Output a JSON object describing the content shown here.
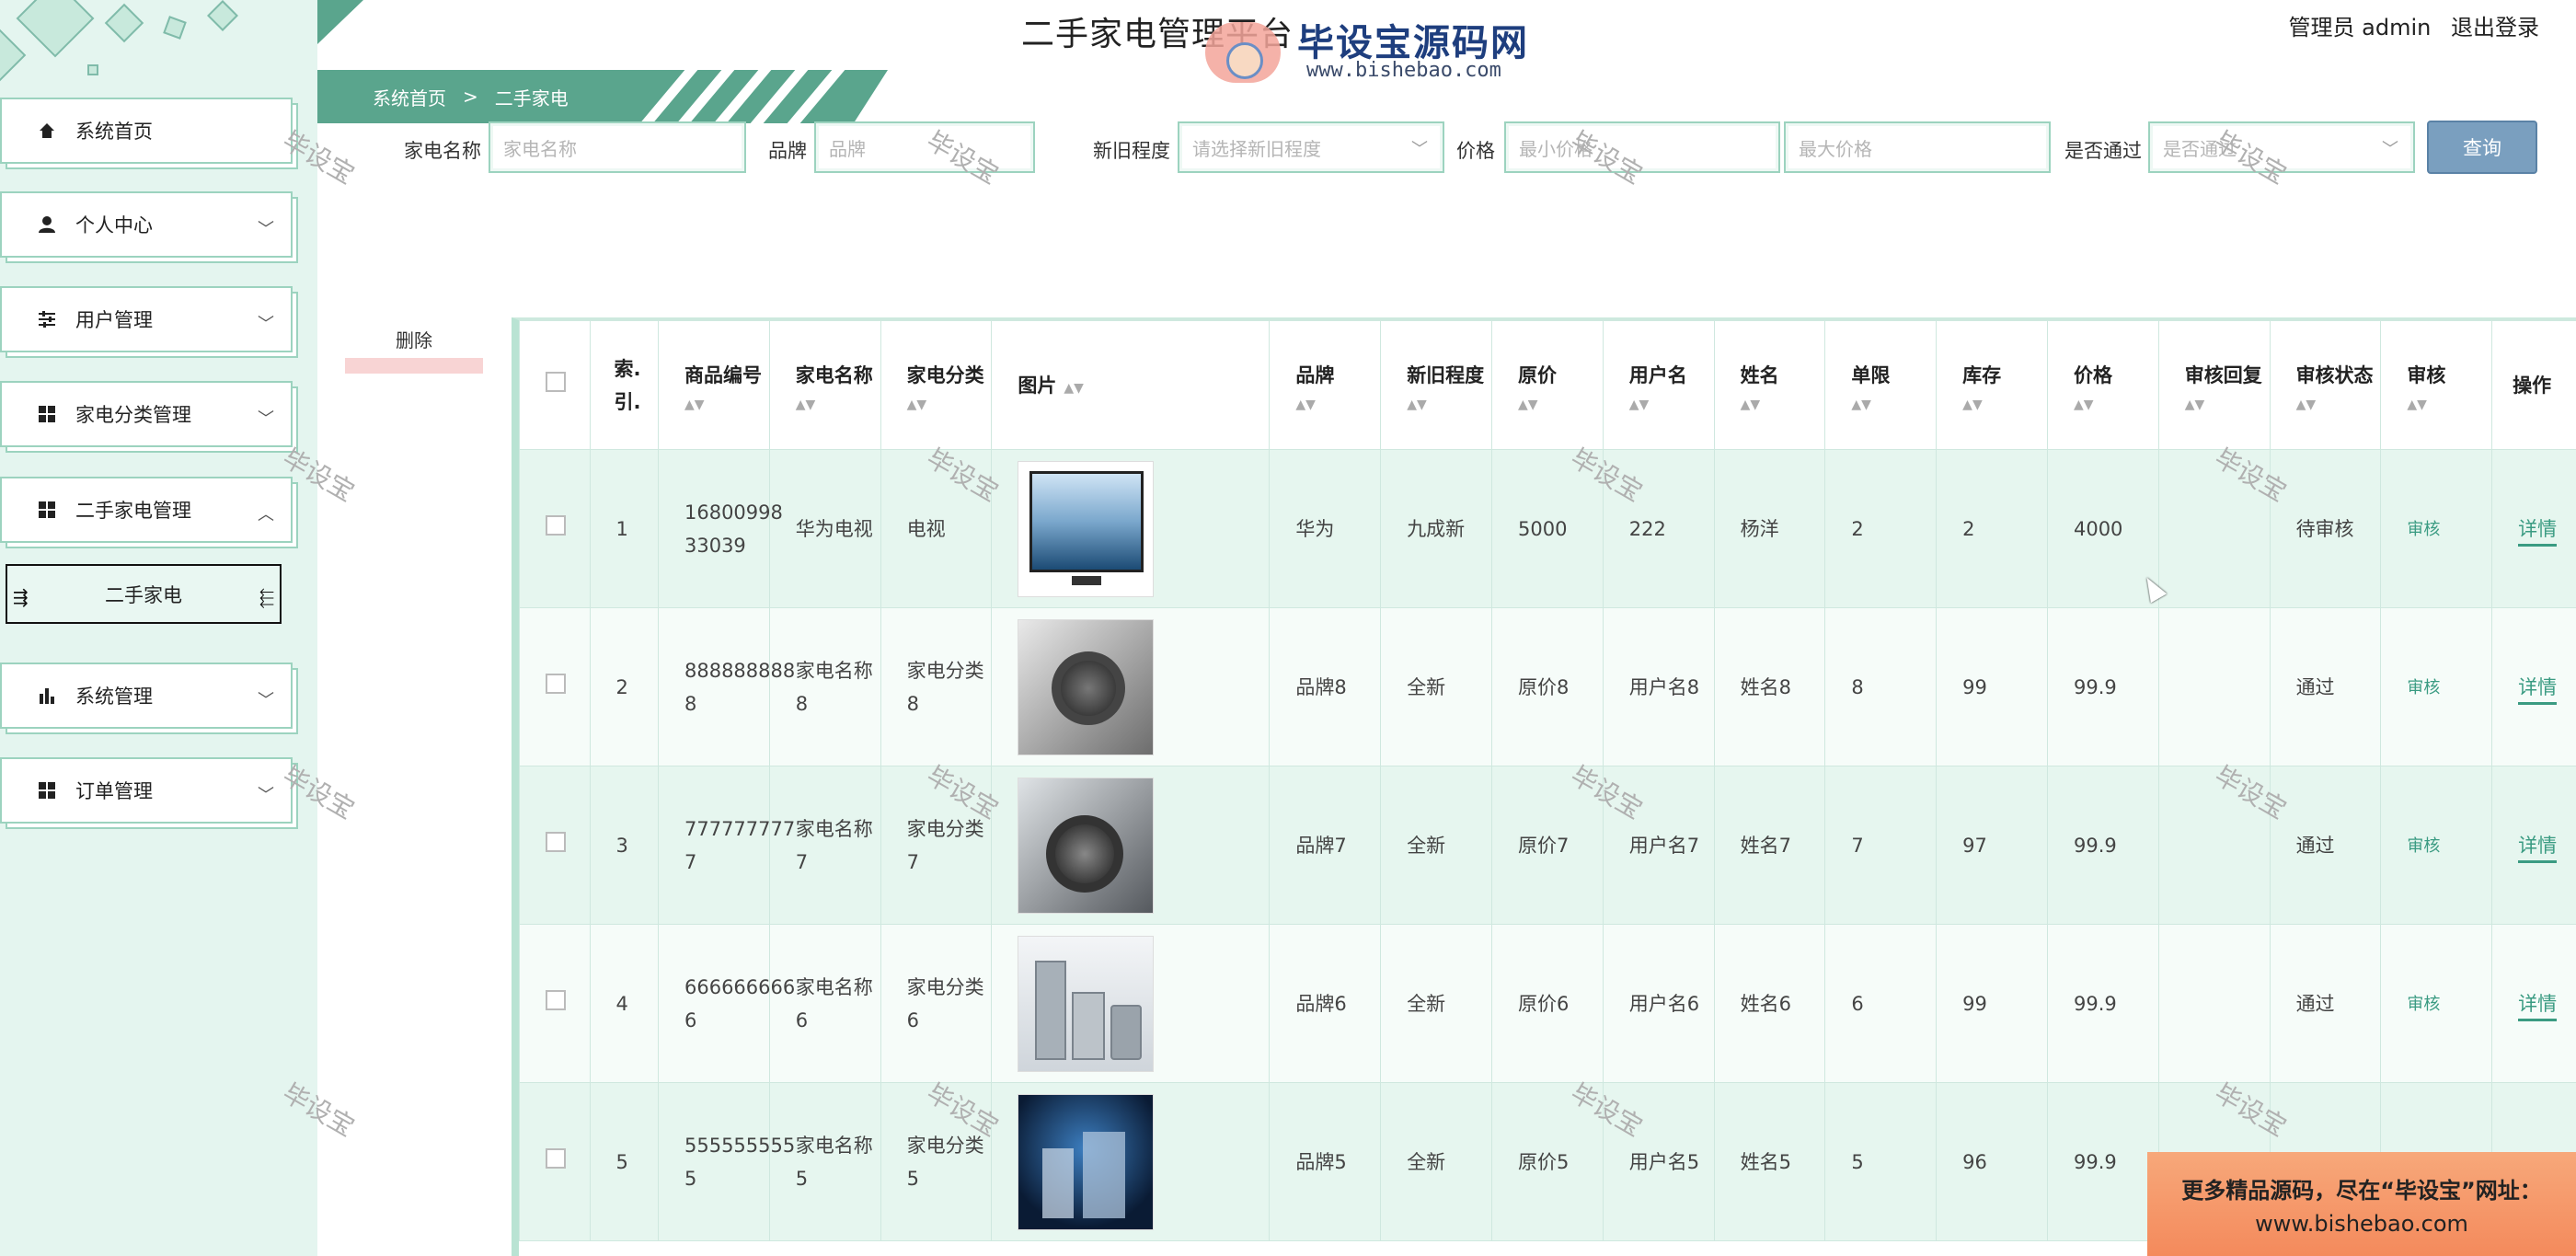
{
  "app": {
    "title": "二手家电管理平台",
    "user_text": "管理员 admin",
    "logout": "退出登录",
    "logo_name": "毕设宝源码网",
    "logo_url": "www.bishebao.com"
  },
  "sidebar": {
    "items": [
      {
        "label": "系统首页",
        "icon": "home-icon",
        "expandable": false
      },
      {
        "label": "个人中心",
        "icon": "user-icon",
        "expandable": true
      },
      {
        "label": "用户管理",
        "icon": "sliders-icon",
        "expandable": true
      },
      {
        "label": "家电分类管理",
        "icon": "grid-icon",
        "expandable": true
      },
      {
        "label": "二手家电管理",
        "icon": "grid-icon",
        "expandable": true,
        "expanded": true
      },
      {
        "label": "系统管理",
        "icon": "bar-chart-icon",
        "expandable": true
      },
      {
        "label": "订单管理",
        "icon": "grid-icon",
        "expandable": true
      }
    ],
    "active_sub": "二手家电"
  },
  "breadcrumb": {
    "home": "系统首页",
    "sep": ">",
    "current": "二手家电"
  },
  "filters": {
    "name_label": "家电名称",
    "name_placeholder": "家电名称",
    "brand_label": "品牌",
    "brand_placeholder": "品牌",
    "condition_label": "新旧程度",
    "condition_placeholder": "请选择新旧程度",
    "price_label": "价格",
    "price_min_placeholder": "最小价格",
    "price_max_placeholder": "最大价格",
    "approved_label": "是否通过",
    "approved_placeholder": "是否通过",
    "query_button": "查询"
  },
  "actions": {
    "delete": "删除"
  },
  "table": {
    "headers": {
      "index": "索.引.",
      "code": "商品编号",
      "name": "家电名称",
      "category": "家电分类",
      "image": "图片",
      "brand": "品牌",
      "condition": "新旧程度",
      "original_price": "原价",
      "username": "用户名",
      "realname": "姓名",
      "limit": "单限",
      "stock": "库存",
      "price": "价格",
      "review_reply": "审核回复",
      "review_status": "审核状态",
      "review": "审核",
      "ops": "操作"
    },
    "review_link": "审核",
    "detail_link": "详情",
    "rows": [
      {
        "index": "1",
        "code": "16800998 33039",
        "name": "华为电视",
        "category": "电视",
        "image": "tv",
        "brand": "华为",
        "condition": "九成新",
        "original_price": "5000",
        "username": "222",
        "realname": "杨洋",
        "limit": "2",
        "stock": "2",
        "price": "4000",
        "review_reply": "",
        "review_status": "待审核"
      },
      {
        "index": "2",
        "code": "888888888 8",
        "name": "家电名称8",
        "category": "家电分类8",
        "image": "washer",
        "brand": "品牌8",
        "condition": "全新",
        "original_price": "原价8",
        "username": "用户名8",
        "realname": "姓名8",
        "limit": "8",
        "stock": "99",
        "price": "99.9",
        "review_reply": "",
        "review_status": "通过"
      },
      {
        "index": "3",
        "code": "777777777 7",
        "name": "家电名称7",
        "category": "家电分类7",
        "image": "washer2",
        "brand": "品牌7",
        "condition": "全新",
        "original_price": "原价7",
        "username": "用户名7",
        "realname": "姓名7",
        "limit": "7",
        "stock": "97",
        "price": "99.9",
        "review_reply": "",
        "review_status": "通过"
      },
      {
        "index": "4",
        "code": "666666666 6",
        "name": "家电名称6",
        "category": "家电分类6",
        "image": "set",
        "brand": "品牌6",
        "condition": "全新",
        "original_price": "原价6",
        "username": "用户名6",
        "realname": "姓名6",
        "limit": "6",
        "stock": "99",
        "price": "99.9",
        "review_reply": "",
        "review_status": "通过"
      },
      {
        "index": "5",
        "code": "555555555 5",
        "name": "家电名称5",
        "category": "家电分类5",
        "image": "dark",
        "brand": "品牌5",
        "condition": "全新",
        "original_price": "原价5",
        "username": "用户名5",
        "realname": "姓名5",
        "limit": "5",
        "stock": "96",
        "price": "99.9",
        "review_reply": "",
        "review_status": ""
      }
    ]
  },
  "watermark": "毕设宝",
  "promo": {
    "line1": "更多精品源码，尽在“毕设宝”网址：",
    "line2": "www.bishebao.com"
  },
  "colors": {
    "accent": "#5aa58d",
    "sidebar_bg": "#e4f5ef",
    "query_btn": "#7a9fbf",
    "link": "#3a9b82"
  }
}
